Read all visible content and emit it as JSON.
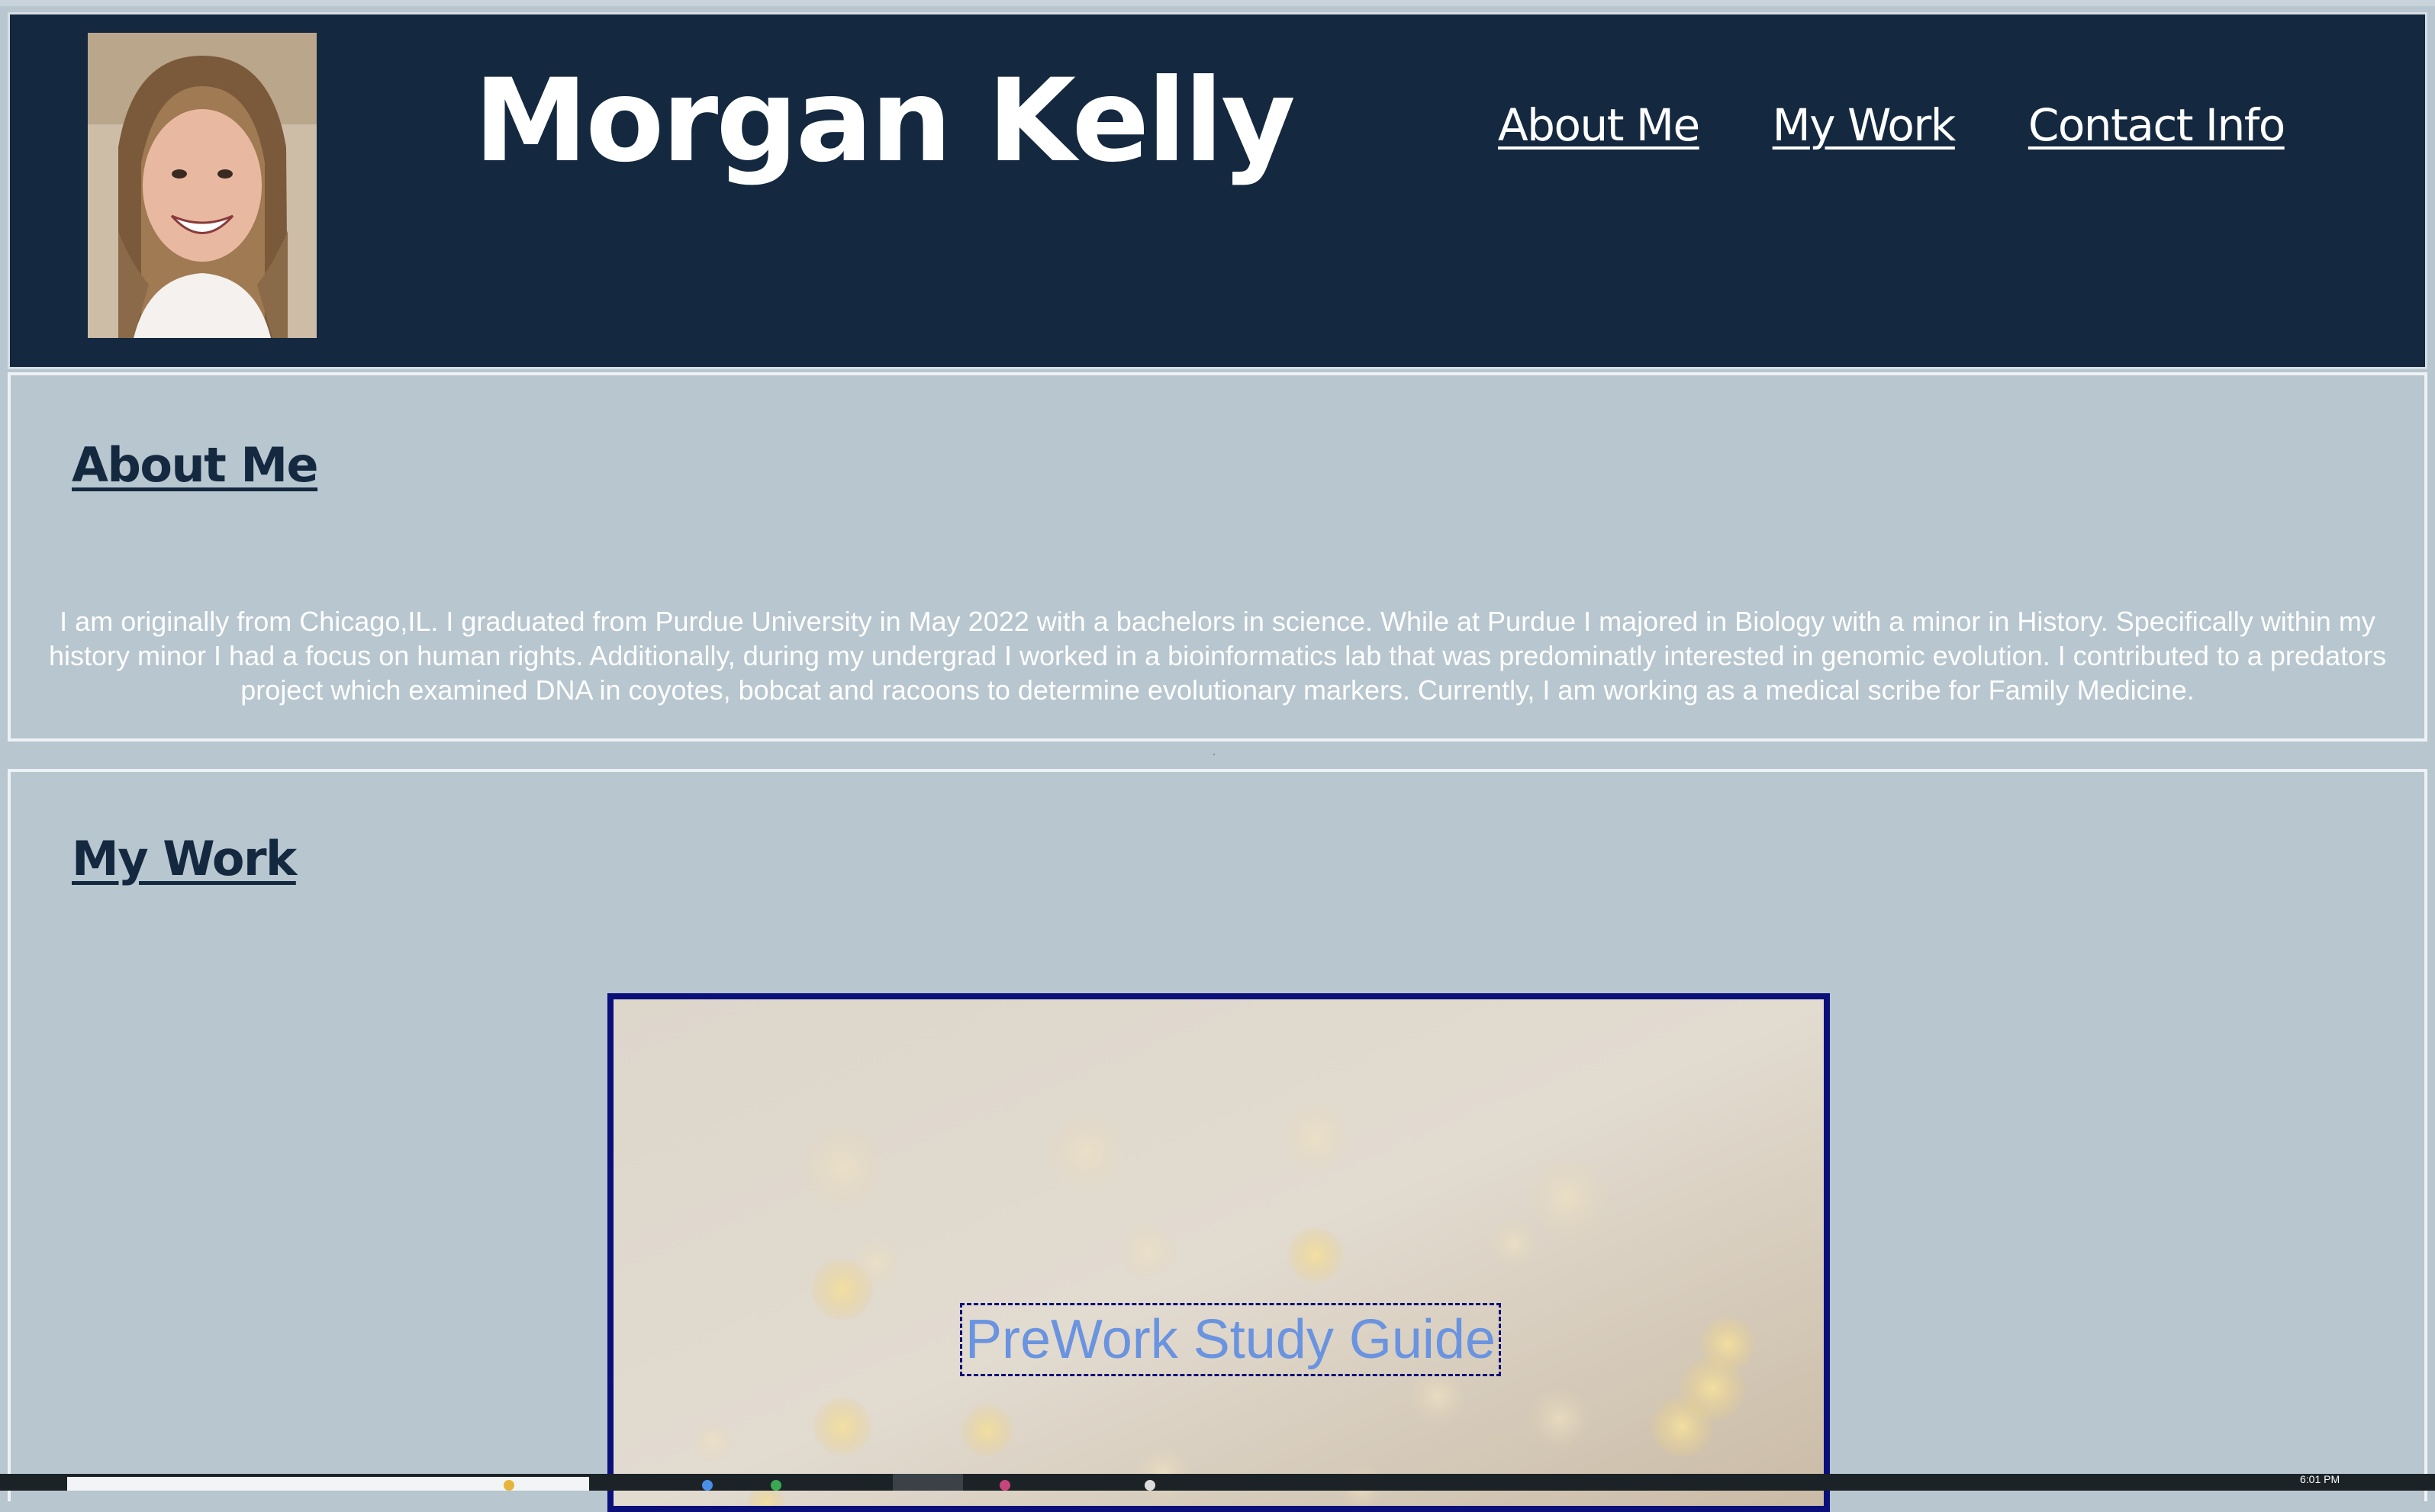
{
  "header": {
    "site_title": "Morgan Kelly",
    "nav": [
      {
        "label": "About Me"
      },
      {
        "label": "My Work"
      },
      {
        "label": "Contact Info"
      }
    ]
  },
  "about": {
    "heading": "About Me",
    "body": "I am originally from Chicago,IL. I graduated from Purdue University in May 2022 with a bachelors in science. While at Purdue I majored in Biology with a minor in History. Specifically within my history minor I had a focus on human rights. Additionally, during my undergrad I worked in a bioinformatics lab that was predominatly interested in genomic evolution. I contributed to a predators project which examined DNA in coyotes, bobcat and racoons to determine evolutionary markers. Currently, I am working as a medical scribe for Family Medicine."
  },
  "work": {
    "heading": "My Work",
    "card_link": "PreWork Study Guide"
  },
  "taskbar": {
    "clock": "6:01 PM"
  },
  "colors": {
    "header_bg": "#14293f",
    "section_bg": "#b7c6cf",
    "card_border": "#0a0f7a",
    "link": "#6a93e0"
  }
}
